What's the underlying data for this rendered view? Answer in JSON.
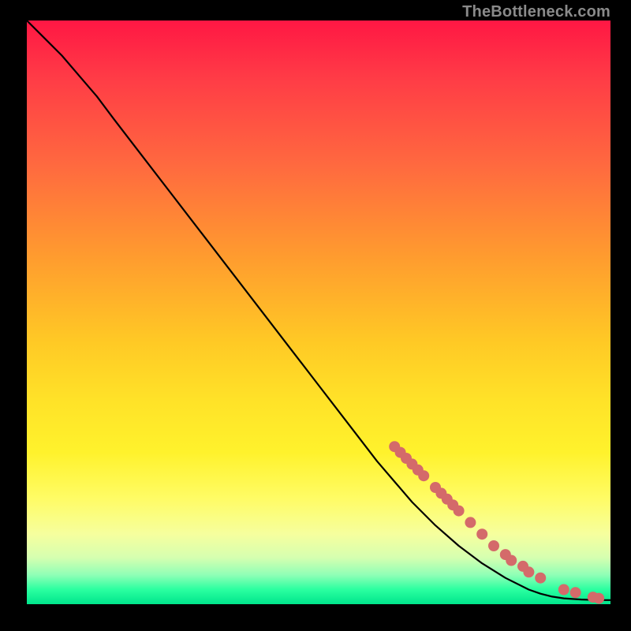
{
  "watermark": "TheBottleneck.com",
  "colors": {
    "background": "#000000",
    "line": "#000000",
    "marker": "#d46a6a"
  },
  "chart_data": {
    "type": "line",
    "title": "",
    "xlabel": "",
    "ylabel": "",
    "xlim": [
      0,
      100
    ],
    "ylim": [
      0,
      100
    ],
    "grid": false,
    "legend": false,
    "series": [
      {
        "name": "curve",
        "style": "line",
        "x": [
          0,
          3,
          6,
          9,
          12,
          15,
          20,
          25,
          30,
          35,
          40,
          45,
          50,
          55,
          60,
          63,
          66,
          70,
          74,
          78,
          82,
          86,
          88,
          90,
          92,
          95,
          98,
          100
        ],
        "y": [
          100,
          97,
          94,
          90.5,
          87,
          83,
          76.5,
          70,
          63.5,
          57,
          50.5,
          44,
          37.5,
          31,
          24.5,
          21,
          17.5,
          13.5,
          10,
          7,
          4.5,
          2.5,
          1.8,
          1.3,
          1.0,
          0.8,
          0.7,
          0.7
        ]
      },
      {
        "name": "highlighted-segment",
        "style": "markers",
        "x": [
          63,
          64,
          65,
          66,
          67,
          68,
          70,
          71,
          72,
          73,
          74,
          76,
          78,
          80,
          82,
          83,
          85,
          86,
          88,
          92,
          94,
          97,
          98
        ],
        "y": [
          27,
          26,
          25,
          24,
          23,
          22,
          20,
          19,
          18,
          17,
          16,
          14,
          12,
          10,
          8.5,
          7.5,
          6.5,
          5.5,
          4.5,
          2.5,
          2.0,
          1.2,
          1.0
        ]
      }
    ]
  }
}
